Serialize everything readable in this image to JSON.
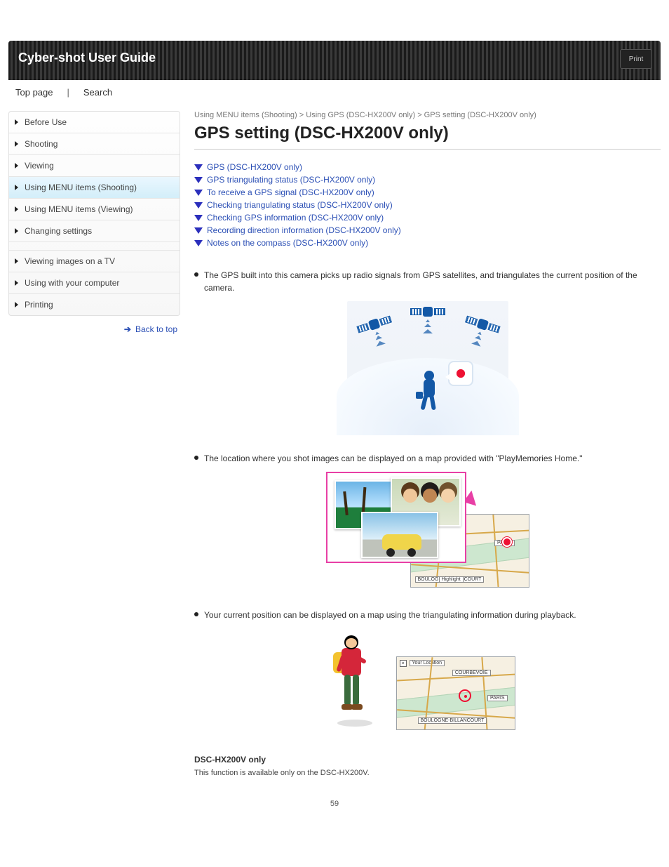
{
  "header": {
    "title": "Cyber-shot User Guide",
    "print_label": "Print",
    "top_link": "Top page",
    "search_label": "Search"
  },
  "sidebar": {
    "items": [
      {
        "label": "Before Use"
      },
      {
        "label": "Shooting"
      },
      {
        "label": "Viewing"
      },
      {
        "label": "Using MENU items (Shooting)"
      },
      {
        "label": "Using MENU items (Viewing)"
      },
      {
        "label": "Changing settings"
      },
      {
        "label": "Viewing images on a TV"
      },
      {
        "label": "Using with your computer"
      },
      {
        "label": "Printing"
      }
    ],
    "selected_index": 3
  },
  "back_to_top": "Back to top",
  "breadcrumb": "Using MENU items (Shooting) > Using GPS (DSC-HX200V only) > GPS setting (DSC-HX200V only)",
  "page": {
    "title": "GPS setting (DSC-HX200V only)",
    "anchors": [
      "GPS (DSC-HX200V only)",
      "GPS triangulating status (DSC-HX200V only)",
      "To receive a GPS signal (DSC-HX200V only)",
      "Checking triangulating status (DSC-HX200V only)",
      "Checking GPS information (DSC-HX200V only)",
      "Recording direction information (DSC-HX200V only)",
      "Notes on the compass (DSC-HX200V only)"
    ],
    "section1": {
      "bullet_text": "The GPS built into this camera picks up radio signals from GPS satellites, and triangulates the current position of the camera.",
      "fig_alt": "gps-satellites-and-person"
    },
    "section2": {
      "bullet_text": "The location where you shot images can be displayed on a map provided with \"PlayMemories Home.\"",
      "fig_alt": "photos-on-map"
    },
    "section3": {
      "bullet_text": "Your current position can be displayed on a map using the triangulating information during playback.",
      "fig_alt": "current-location-map"
    },
    "only_model_label": "DSC-HX200V only",
    "only_model_note": "This function is available only on the DSC-HX200V."
  },
  "map_labels": {
    "your_location": "Your Location",
    "paris": "PARIS",
    "courbevoie": "COURBEVOIE",
    "boulogne": "BOULOGNE-BILLANCOURT",
    "highlight": "Highlight"
  },
  "page_number": "59"
}
